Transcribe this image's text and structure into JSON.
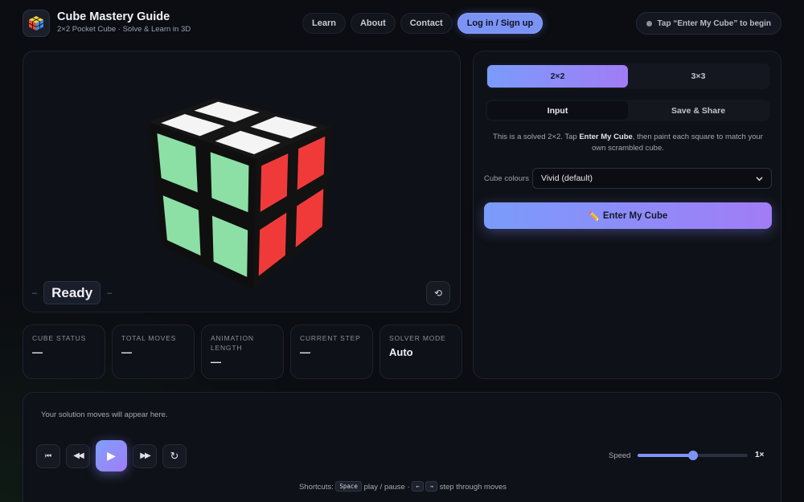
{
  "header": {
    "brand_title": "Cube Mastery Guide",
    "brand_subtitle": "2×2 Pocket Cube · Solve & Learn in 3D",
    "logo_icon": "rubiks-cube-icon",
    "nav": [
      {
        "label": "Learn"
      },
      {
        "label": "About"
      },
      {
        "label": "Contact"
      },
      {
        "label": "Log in / Sign up",
        "primary": true
      }
    ],
    "hint": "Tap “Enter My Cube” to begin"
  },
  "viewer": {
    "status_text": "Ready",
    "dash_left": "–",
    "dash_right": "–",
    "reset_icon": "rotate-view-icon",
    "reset_glyph": "⟲",
    "cube_colors": {
      "top": "#f4f4f4",
      "front": "#8ce0a6",
      "right": "#f03a3a",
      "body": "#141414"
    }
  },
  "stats": [
    {
      "label": "CUBE STATUS",
      "value": "—"
    },
    {
      "label": "TOTAL MOVES",
      "value": "—"
    },
    {
      "label": "ANIMATION LENGTH",
      "value": "—"
    },
    {
      "label": "CURRENT STEP",
      "value": "—"
    },
    {
      "label": "SOLVER MODE",
      "value": "Auto"
    }
  ],
  "side": {
    "size_options": [
      {
        "label": "2×2",
        "active": true
      },
      {
        "label": "3×3",
        "active": false
      }
    ],
    "tabs": [
      {
        "label": "Input",
        "active": true
      },
      {
        "label": "Save & Share",
        "active": false
      }
    ],
    "description_pre": "This is a solved 2×2. Tap ",
    "description_bold": "Enter My Cube",
    "description_post": ", then paint each square to match your own scrambled cube.",
    "colour_label": "Cube colours",
    "colour_value": "Vivid (default)",
    "enter_icon": "pencil-icon",
    "enter_glyph": "✏️",
    "enter_label": "Enter My Cube"
  },
  "playback": {
    "solution_placeholder": "Your solution moves will appear here.",
    "controls": [
      {
        "name": "skip-to-start-button",
        "icon": "skip-start-icon",
        "glyph": "⏮"
      },
      {
        "name": "step-back-button",
        "icon": "rewind-icon",
        "glyph": "◀◀"
      },
      {
        "name": "play-button",
        "icon": "play-icon",
        "glyph": "▶",
        "primary": true
      },
      {
        "name": "step-forward-button",
        "icon": "fast-forward-icon",
        "glyph": "▶▶"
      },
      {
        "name": "replay-button",
        "icon": "replay-icon",
        "glyph": "↻"
      }
    ],
    "speed_label": "Speed",
    "speed_value": "1×",
    "speed_fraction": 0.5,
    "shortcuts_prefix": "Shortcuts:",
    "shortcut_key_space": "Space",
    "shortcut_play": "play / pause ·",
    "shortcut_key_left": "←",
    "shortcut_key_right": "→",
    "shortcut_step": "step through moves"
  },
  "colors": {
    "accent_start": "#7a9cfb",
    "accent_end": "#a17cf6"
  }
}
